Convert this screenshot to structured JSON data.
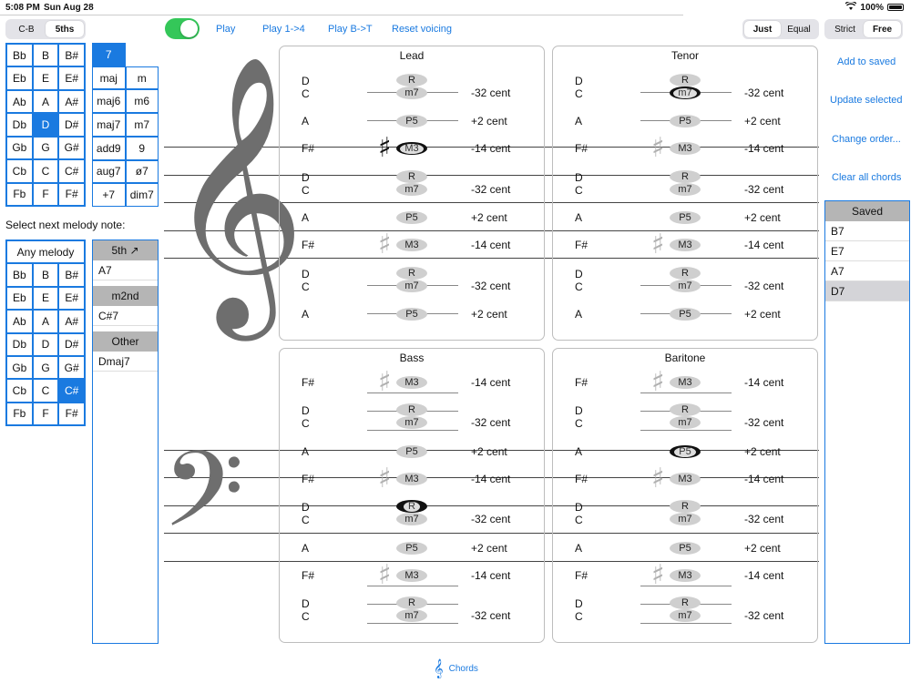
{
  "status": {
    "time": "5:08 PM",
    "date": "Sun Aug 28",
    "battery": "100%"
  },
  "modes": {
    "order": [
      "C-B",
      "5ths"
    ],
    "tuning": [
      "Just",
      "Equal"
    ],
    "strictness": [
      "Strict",
      "Free"
    ]
  },
  "playback": {
    "play": "Play",
    "play_up": "Play 1->4",
    "play_down": "Play B->T",
    "reset": "Reset voicing"
  },
  "actions": {
    "add": "Add to saved",
    "update": "Update selected",
    "reorder": "Change order...",
    "clear": "Clear all chords"
  },
  "root_grid": [
    "Bb",
    "B",
    "B#",
    "Eb",
    "E",
    "E#",
    "Ab",
    "A",
    "A#",
    "Db",
    "D",
    "D#",
    "Gb",
    "G",
    "G#",
    "Cb",
    "C",
    "C#",
    "Fb",
    "F",
    "F#"
  ],
  "quality_grid": [
    "7",
    "",
    "maj",
    "m",
    "maj6",
    "m6",
    "maj7",
    "m7",
    "add9",
    "9",
    "aug7",
    "ø7",
    "+7",
    "dim7"
  ],
  "melody": {
    "prompt": "Select next melody note:",
    "any": "Any melody",
    "notes": [
      "Bb",
      "B",
      "B#",
      "Eb",
      "E",
      "E#",
      "Ab",
      "A",
      "A#",
      "Db",
      "D",
      "D#",
      "Gb",
      "G",
      "G#",
      "Cb",
      "C",
      "C#",
      "Fb",
      "F",
      "F#"
    ]
  },
  "suggestions": [
    {
      "head": "5th ↗",
      "items": [
        "A7"
      ]
    },
    {
      "head": "m2nd",
      "items": [
        "C#7"
      ]
    },
    {
      "head": "Other",
      "items": [
        "Dmaj7"
      ]
    }
  ],
  "saved": {
    "title": "Saved",
    "items": [
      "B7",
      "E7",
      "A7",
      "D7"
    ]
  },
  "voices": {
    "lead": "Lead",
    "tenor": "Tenor",
    "bass": "Bass",
    "baritone": "Baritone"
  },
  "chord_rows": {
    "dc_notes": [
      "D",
      "C"
    ],
    "dc_ivl": [
      "R",
      "m7"
    ],
    "dc_cent": "-32 cent",
    "a_note": "A",
    "a_ivl": "P5",
    "a_cent": "+2 cent",
    "fs_note": "F#",
    "fs_ivl": "M3",
    "fs_cent": "-14 cent",
    "sharp": "♯"
  },
  "bottom_tab": "Chords",
  "colors": {
    "accent": "#1a7ae0",
    "toggle": "#34c759"
  }
}
